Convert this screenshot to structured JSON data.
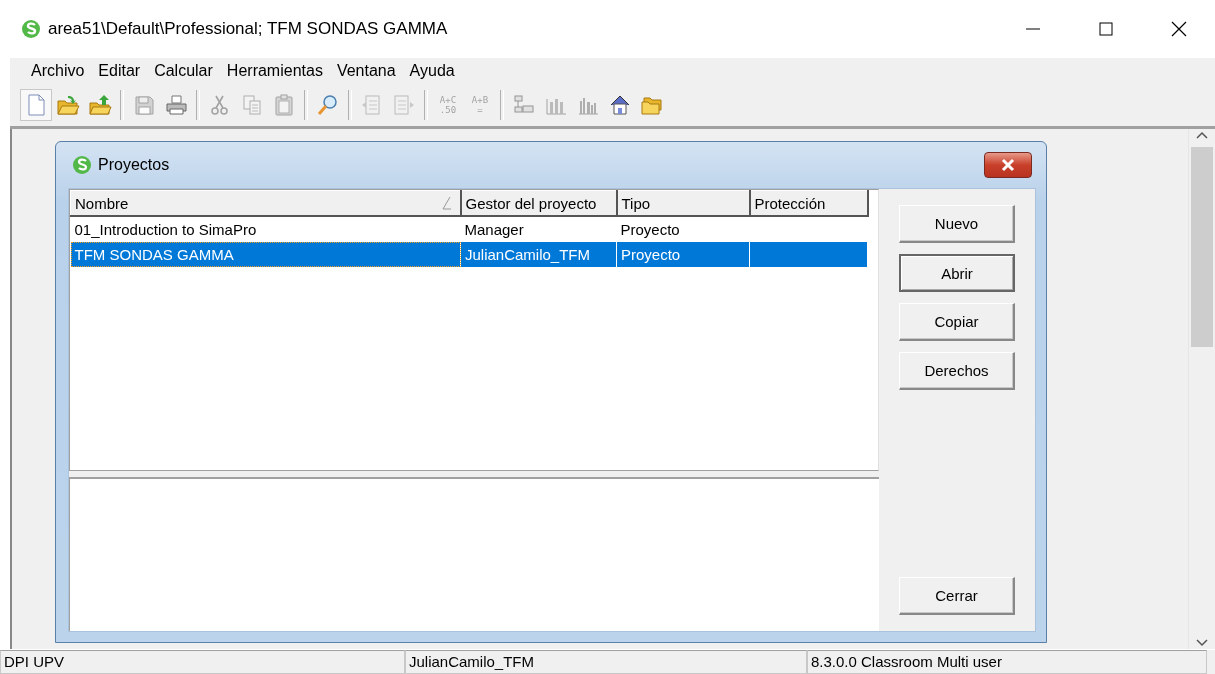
{
  "window": {
    "title": "area51\\Default\\Professional; TFM SONDAS GAMMA"
  },
  "menu": [
    "Archivo",
    "Editar",
    "Calcular",
    "Herramientas",
    "Ventana",
    "Ayuda"
  ],
  "toolbar": [
    {
      "kind": "document",
      "disabled": false
    },
    {
      "kind": "folder-open",
      "disabled": false
    },
    {
      "kind": "folder-up",
      "disabled": false
    },
    {
      "kind": "separator"
    },
    {
      "kind": "floppy",
      "disabled": true
    },
    {
      "kind": "printer",
      "disabled": false
    },
    {
      "kind": "separator"
    },
    {
      "kind": "scissors",
      "disabled": true
    },
    {
      "kind": "copy",
      "disabled": true
    },
    {
      "kind": "clipboard",
      "disabled": true
    },
    {
      "kind": "separator"
    },
    {
      "kind": "magnifier",
      "disabled": false
    },
    {
      "kind": "separator"
    },
    {
      "kind": "list-left",
      "disabled": true
    },
    {
      "kind": "list-right",
      "disabled": true
    },
    {
      "kind": "separator"
    },
    {
      "kind": "text",
      "lines": [
        "A+C",
        ".50"
      ],
      "disabled": true
    },
    {
      "kind": "text",
      "lines": [
        "A+B",
        "="
      ],
      "disabled": true
    },
    {
      "kind": "separator"
    },
    {
      "kind": "tree",
      "disabled": true
    },
    {
      "kind": "bars",
      "disabled": true
    },
    {
      "kind": "bars-dense",
      "disabled": true
    },
    {
      "kind": "house",
      "disabled": false
    },
    {
      "kind": "folders",
      "disabled": false
    }
  ],
  "dialog": {
    "title": "Proyectos",
    "table": {
      "columns": [
        "Nombre",
        "Gestor del proyecto",
        "Tipo",
        "Protección"
      ],
      "rows": [
        {
          "cells": [
            "01_Introduction to SimaPro",
            "Manager",
            "Proyecto",
            ""
          ],
          "selected": false
        },
        {
          "cells": [
            "TFM SONDAS GAMMA",
            "JulianCamilo_TFM",
            "Proyecto",
            ""
          ],
          "selected": true
        }
      ]
    },
    "buttons": [
      {
        "label": "Nuevo",
        "default": false
      },
      {
        "label": "Abrir",
        "default": true
      },
      {
        "label": "Copiar",
        "default": false
      },
      {
        "label": "Derechos",
        "default": false
      }
    ],
    "close_button": {
      "label": "Cerrar",
      "default": false
    }
  },
  "status_bar": [
    "DPI UPV",
    "JulianCamilo_TFM",
    "8.3.0.0 Classroom Multi user"
  ]
}
